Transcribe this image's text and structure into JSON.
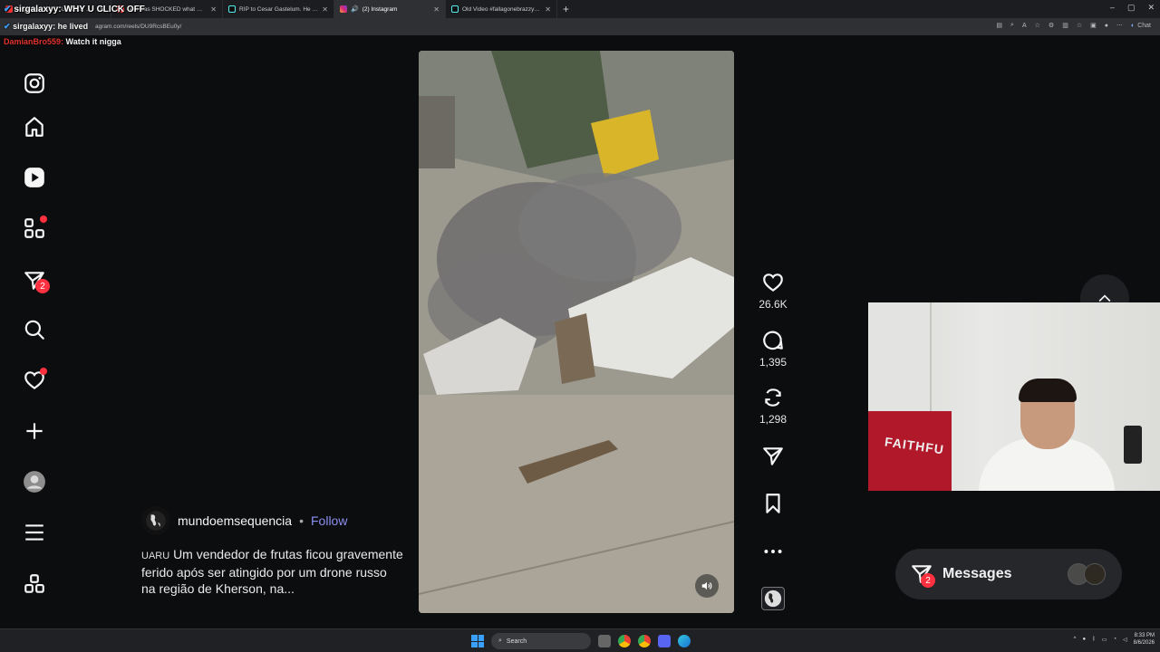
{
  "browser": {
    "tabs": [
      {
        "title": "sirgalaxyy: WHY U CLICK OFF",
        "active": false
      },
      {
        "title": "Ash was SHOCKED what Oblivion",
        "active": false
      },
      {
        "title": "RIP to Cesar Gastelum. He live stre",
        "active": false
      },
      {
        "title": "(2) Instagram",
        "active": true
      },
      {
        "title": "Old Video #fallagonebrazzy #alan",
        "active": false
      }
    ],
    "new_tab": "+",
    "url": "agram.com/reels/DU9RcsBEu0y/",
    "chat_button": "Chat"
  },
  "overlays": {
    "title_name": "sirgalaxyy:",
    "title_text": "WHY U CLICK OFF",
    "sub_name": "sirgalaxyy:",
    "sub_text": "he lived",
    "chat_user": "DamianBro559:",
    "chat_text": "Watch it nigga"
  },
  "sidebar": {
    "items": [
      {
        "icon": "instagram-logo-icon"
      },
      {
        "icon": "home-icon"
      },
      {
        "icon": "reels-icon"
      },
      {
        "icon": "explore-icon",
        "dot": true
      },
      {
        "icon": "messages-icon",
        "badge": "2"
      },
      {
        "icon": "search-icon"
      },
      {
        "icon": "notifications-icon",
        "dot": true
      },
      {
        "icon": "create-icon"
      },
      {
        "icon": "profile-icon"
      },
      {
        "icon": "menu-icon"
      },
      {
        "icon": "more-apps-icon"
      }
    ]
  },
  "reel": {
    "author": "mundoemsequencia",
    "separator": "•",
    "follow": "Follow",
    "caption_prefix": "UARU",
    "caption": "Um vendedor de frutas ficou gravemente ferido após ser atingido por um drone russo na região de Kherson, na..."
  },
  "actions": {
    "likes": "26.6K",
    "comments": "1,395",
    "reposts": "1,298"
  },
  "messages": {
    "label": "Messages",
    "badge": "2"
  },
  "webcam": {
    "flag_text": "FAITHFU"
  },
  "taskbar": {
    "search_placeholder": "Search",
    "time": "8:33 PM",
    "date": "8/6/2026"
  },
  "colors": {
    "accent_link": "#8b8ff0",
    "notification_red": "#ff3040",
    "page_bg": "#0c0d0f"
  }
}
